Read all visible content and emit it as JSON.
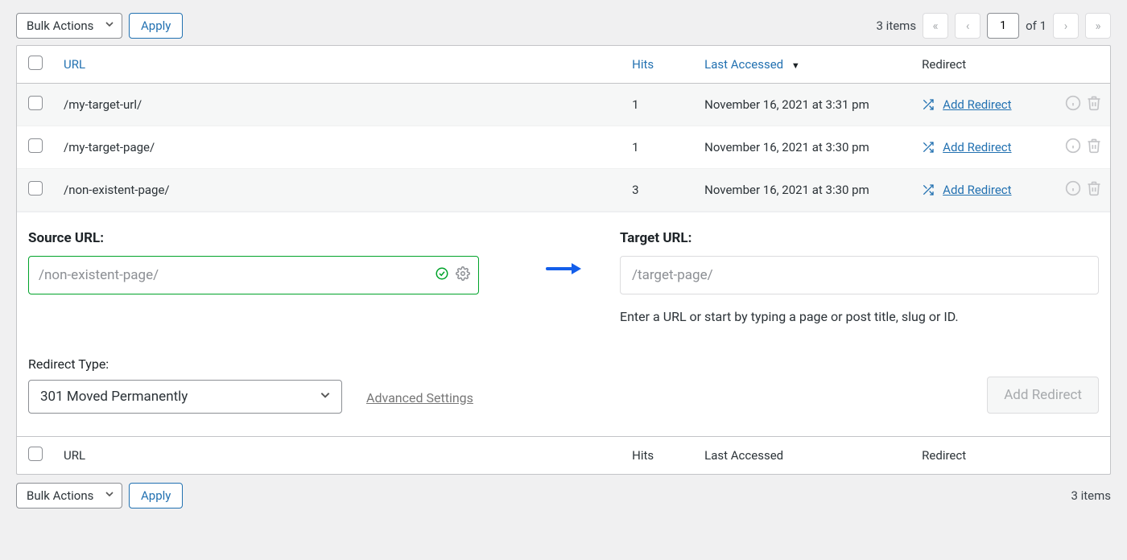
{
  "bulk_actions": {
    "label": "Bulk Actions",
    "apply": "Apply"
  },
  "pagination": {
    "items_label": "3 items",
    "page": "1",
    "of_label": "of 1"
  },
  "columns": {
    "url": "URL",
    "hits": "Hits",
    "last_accessed": "Last Accessed",
    "redirect": "Redirect"
  },
  "rows": [
    {
      "url": "/my-target-url/",
      "hits": "1",
      "date": "November 16, 2021 at 3:31 pm",
      "action": "Add Redirect"
    },
    {
      "url": "/my-target-page/",
      "hits": "1",
      "date": "November 16, 2021 at 3:30 pm",
      "action": "Add Redirect"
    },
    {
      "url": "/non-existent-page/",
      "hits": "3",
      "date": "November 16, 2021 at 3:30 pm",
      "action": "Add Redirect"
    }
  ],
  "form": {
    "source_label": "Source URL:",
    "source_value": "/non-existent-page/",
    "target_label": "Target URL:",
    "target_placeholder": "/target-page/",
    "target_hint": "Enter a URL or start by typing a page or post title, slug or ID.",
    "type_label": "Redirect Type:",
    "type_value": "301 Moved Permanently",
    "advanced": "Advanced Settings",
    "add_button": "Add Redirect"
  }
}
